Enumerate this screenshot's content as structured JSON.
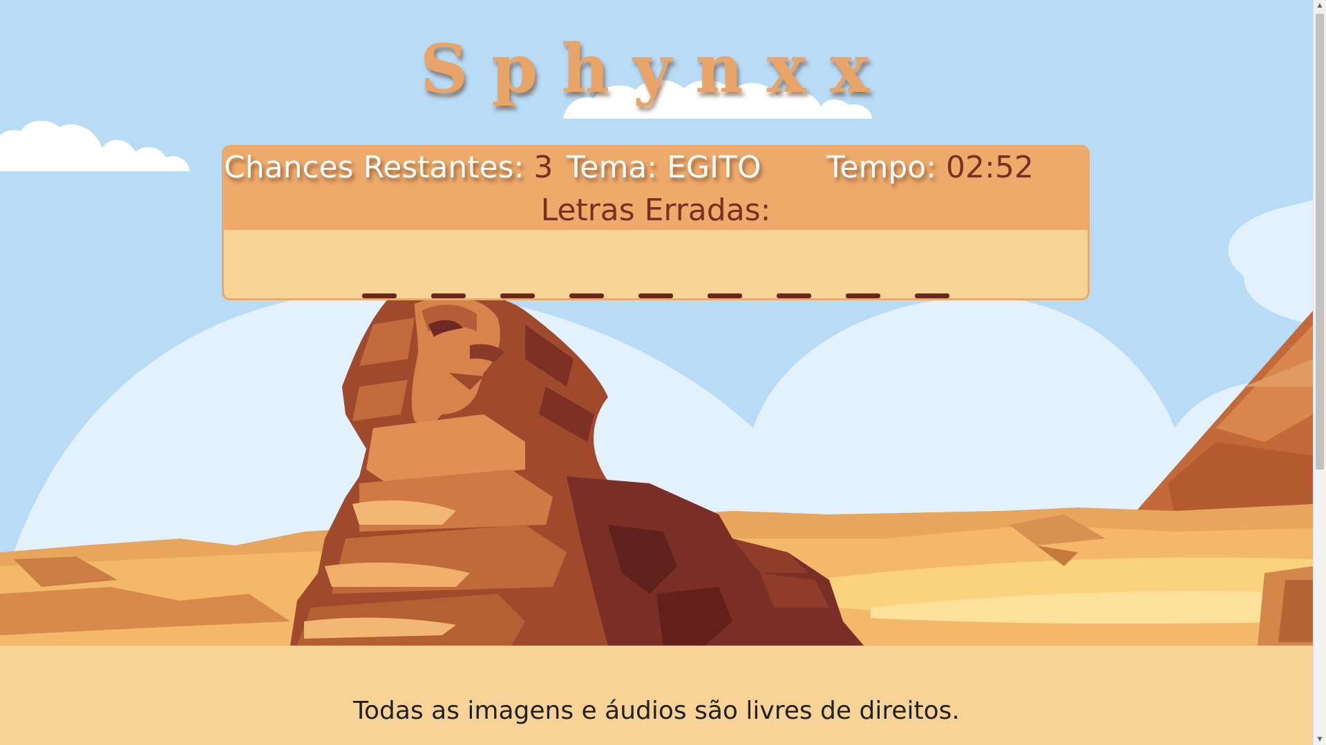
{
  "game": {
    "title": "Sphynxx",
    "chances_label": "Chances Restantes:",
    "chances_value": "3",
    "theme_label": "Tema:",
    "theme_value": "EGITO",
    "time_label": "Tempo:",
    "time_value": "02:52",
    "wrong_letters_label": "Letras Erradas:",
    "wrong_letters": "",
    "word_length": 9
  },
  "footer": {
    "text": "Todas as imagens e áudios são livres de direitos."
  },
  "colors": {
    "sky": "#b8dbf6",
    "panel_header": "#eeaa6a",
    "panel_body": "#f8d398",
    "accent_text": "#7a2f25",
    "title": "#e9a468"
  }
}
